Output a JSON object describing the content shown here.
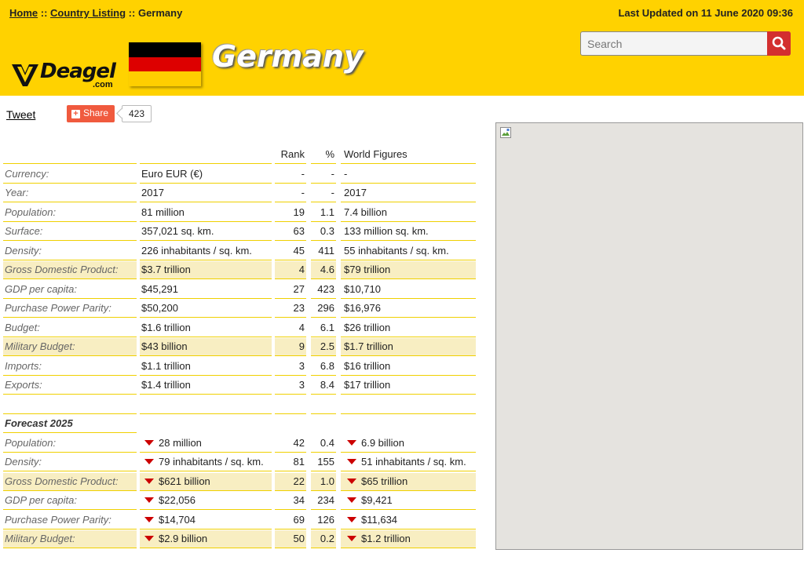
{
  "breadcrumb": {
    "home": "Home",
    "sep1": " :: ",
    "country_listing": "Country Listing",
    "sep2": " :: ",
    "current": "Germany"
  },
  "last_updated": "Last Updated on 11 June 2020 09:36",
  "logo": {
    "word": "Deagel",
    "com": ".com"
  },
  "page_title": "Germany",
  "search": {
    "placeholder": "Search"
  },
  "social": {
    "tweet": "Tweet",
    "share": "Share",
    "share_count": "423"
  },
  "colors": {
    "header": "#ffd200",
    "highlight_row": "#f8eec2",
    "row_rule": "#f0d000",
    "share": "#f05a3e",
    "search_button": "#d32f2f",
    "down_arrow": "#cc0000"
  },
  "flag_colors": [
    "#000000",
    "#dd0000",
    "#ffce00"
  ],
  "table": {
    "headers": {
      "label": "",
      "value": "",
      "rank": "Rank",
      "pct": "%",
      "world": "World Figures"
    },
    "rows": [
      {
        "label": "Currency:",
        "value": "Euro EUR (€)",
        "rank": "-",
        "pct": "-",
        "world": "-",
        "hl": false
      },
      {
        "label": "Year:",
        "value": "2017",
        "rank": "-",
        "pct": "-",
        "world": "2017",
        "hl": false
      },
      {
        "label": "Population:",
        "value": "81 million",
        "rank": "19",
        "pct": "1.1",
        "world": "7.4 billion",
        "hl": false
      },
      {
        "label": "Surface:",
        "value": "357,021 sq. km.",
        "rank": "63",
        "pct": "0.3",
        "world": "133 million sq. km.",
        "hl": false
      },
      {
        "label": "Density:",
        "value": "226 inhabitants / sq. km.",
        "rank": "45",
        "pct": "411",
        "world": "55 inhabitants / sq. km.",
        "hl": false
      },
      {
        "label": "Gross Domestic Product:",
        "value": "$3.7 trillion",
        "rank": "4",
        "pct": "4.6",
        "world": "$79 trillion",
        "hl": true
      },
      {
        "label": "GDP per capita:",
        "value": "$45,291",
        "rank": "27",
        "pct": "423",
        "world": "$10,710",
        "hl": false
      },
      {
        "label": "Purchase Power Parity:",
        "value": "$50,200",
        "rank": "23",
        "pct": "296",
        "world": "$16,976",
        "hl": false
      },
      {
        "label": "Budget:",
        "value": "$1.6 trillion",
        "rank": "4",
        "pct": "6.1",
        "world": "$26 trillion",
        "hl": false
      },
      {
        "label": "Military Budget:",
        "value": "$43 billion",
        "rank": "9",
        "pct": "2.5",
        "world": "$1.7 trillion",
        "hl": true
      },
      {
        "label": "Imports:",
        "value": "$1.1 trillion",
        "rank": "3",
        "pct": "6.8",
        "world": "$16 trillion",
        "hl": false
      },
      {
        "label": "Exports:",
        "value": "$1.4 trillion",
        "rank": "3",
        "pct": "8.4",
        "world": "$17 trillion",
        "hl": false
      }
    ],
    "forecast_title": "Forecast 2025",
    "forecast_rows": [
      {
        "label": "Population:",
        "value": "28 million",
        "rank": "42",
        "pct": "0.4",
        "world": "6.9 billion",
        "hl": false
      },
      {
        "label": "Density:",
        "value": "79 inhabitants / sq. km.",
        "rank": "81",
        "pct": "155",
        "world": "51 inhabitants / sq. km.",
        "hl": false
      },
      {
        "label": "Gross Domestic Product:",
        "value": "$621 billion",
        "rank": "22",
        "pct": "1.0",
        "world": "$65 trillion",
        "hl": true
      },
      {
        "label": "GDP per capita:",
        "value": "$22,056",
        "rank": "34",
        "pct": "234",
        "world": "$9,421",
        "hl": false
      },
      {
        "label": "Purchase Power Parity:",
        "value": "$14,704",
        "rank": "69",
        "pct": "126",
        "world": "$11,634",
        "hl": false
      },
      {
        "label": "Military Budget:",
        "value": "$2.9 billion",
        "rank": "50",
        "pct": "0.2",
        "world": "$1.2 trillion",
        "hl": true
      }
    ]
  }
}
